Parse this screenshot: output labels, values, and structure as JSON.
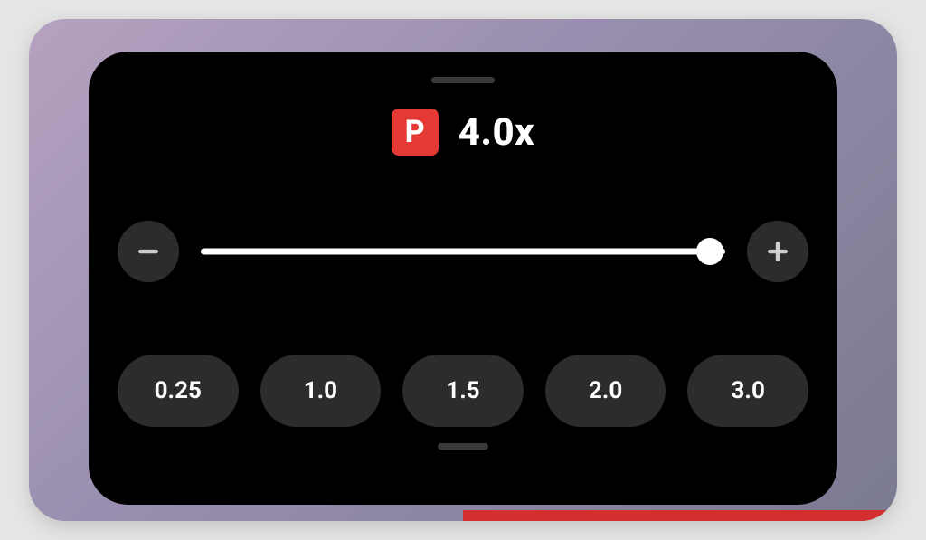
{
  "badge": {
    "letter": "P"
  },
  "speed": {
    "display": "4.0x",
    "slider_percent": 97
  },
  "presets": [
    {
      "label": "0.25"
    },
    {
      "label": "1.0"
    },
    {
      "label": "1.5"
    },
    {
      "label": "2.0"
    },
    {
      "label": "3.0"
    }
  ],
  "colors": {
    "accent": "#e53935",
    "panel_bg": "#000000",
    "button_bg": "#2c2c2c"
  }
}
